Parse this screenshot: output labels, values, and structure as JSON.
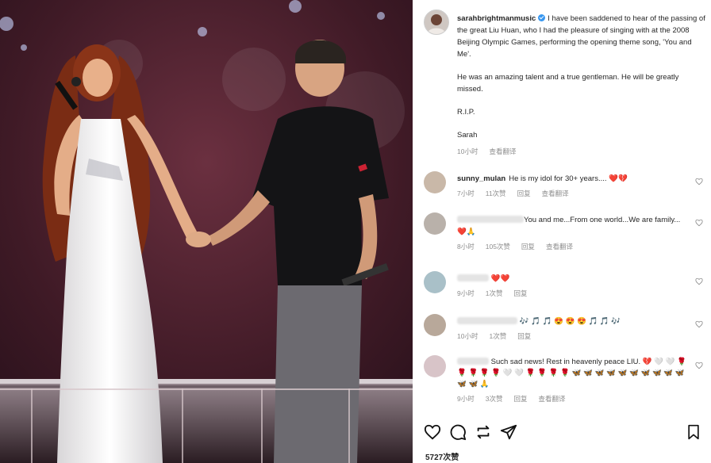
{
  "post": {
    "username": "sarahbrightmanmusic",
    "caption_lines": [
      "I have been saddened to hear of the passing of the great Liu Huan, who I had the pleasure of singing with at the 2008 Beijing Olympic Games, performing the opening theme song, 'You and Me'.",
      "He was an amazing talent and a true gentleman. He will be greatly missed.",
      "R.I.P.",
      "Sarah"
    ],
    "time": "10小时",
    "see_translation": "查看翻译"
  },
  "comments": [
    {
      "user": "sunny_mulan",
      "text": "He is my idol for 30+ years....",
      "emoji": "❤️💔",
      "time": "7小时",
      "likes": "11次赞",
      "reply": "回复",
      "translate": "查看翻译"
    },
    {
      "user": "",
      "text": "You and me...From one world...We are family...",
      "emoji": "❤️🙏",
      "time": "8小时",
      "likes": "105次赞",
      "reply": "回复",
      "translate": "查看翻译"
    },
    {
      "user": "",
      "text": "",
      "emoji": "❤️❤️",
      "time": "9小时",
      "likes": "1次赞",
      "reply": "回复",
      "translate": ""
    },
    {
      "user": "",
      "text": "",
      "emoji": "🎶 🎵 🎵 😍 😍 😍 🎵 🎵 🎶",
      "time": "10小时",
      "likes": "1次赞",
      "reply": "回复",
      "translate": ""
    },
    {
      "user": "",
      "text": "Such sad news! Rest in heavenly peace LIU.",
      "emoji": "💔 🤍 🤍 🌹 🌹 🌹 🌹 🌹 🤍 🤍 🌹 🌹 🌹 🌹 🦋 🦋 🦋 🦋 🦋 🦋 🦋 🦋 🦋 🦋 🦋 🦋 🙏",
      "time": "9小时",
      "likes": "3次赞",
      "reply": "回复",
      "translate": "查看翻译"
    }
  ],
  "likes_total": "5727次赞",
  "icons": [
    "heart-icon",
    "comment-icon",
    "repost-icon",
    "share-icon",
    "bookmark-icon",
    "verified-icon"
  ]
}
